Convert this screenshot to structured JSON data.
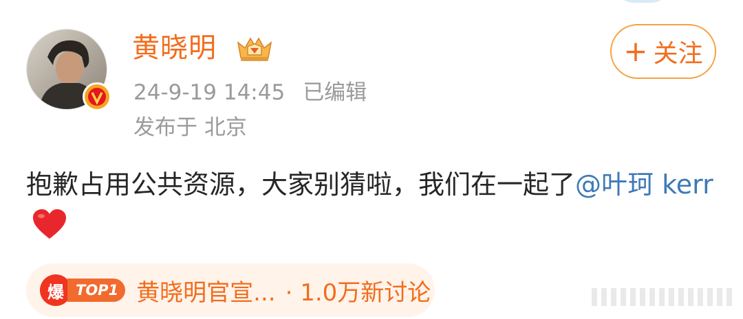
{
  "author": {
    "name": "黄晓明",
    "avatar": "avatar",
    "verified_icon": "verified-v-icon",
    "badge_icon": "crown-badge-icon"
  },
  "follow_button": {
    "label": "关注",
    "icon": "plus-icon"
  },
  "post_meta": {
    "time": "24-9-19 14:45",
    "edited": "已编辑",
    "location": "发布于 北京"
  },
  "content": {
    "text": "抱歉占用公共资源，大家别猜啦，我们在一起了",
    "mention": "@叶珂 kerr",
    "emoji": "heart-icon"
  },
  "hot_tag": {
    "fire_label": "爆",
    "rank_label": "TOP1",
    "title": "黄晓明官宣...",
    "discussion": "· 1.0万新讨论"
  },
  "colors": {
    "accent": "#f26d1c",
    "mention": "#3d79b8",
    "meta_gray": "#9a9a9a"
  }
}
